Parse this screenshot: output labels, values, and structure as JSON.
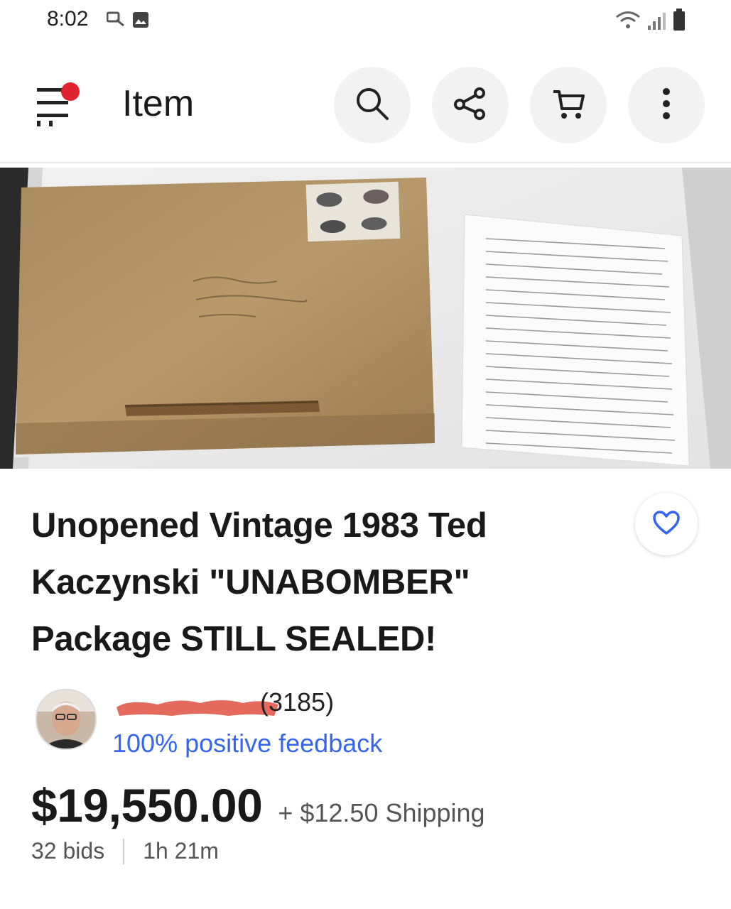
{
  "status_bar": {
    "time": "8:02",
    "icons_left": [
      "notification-icon",
      "image-icon"
    ],
    "icons_right": [
      "wifi-icon",
      "signal-icon",
      "battery-icon"
    ]
  },
  "header": {
    "title": "Item",
    "menu_icon": "menu-icon",
    "actions": [
      "search-icon",
      "share-icon",
      "cart-icon",
      "more-icon"
    ],
    "badge_color": "#e0232e"
  },
  "listing": {
    "title": "Unopened Vintage 1983 Ted Kaczynski \"UNABOMBER\" Package STILL SEALED!",
    "watch_icon": "heart-icon"
  },
  "seller": {
    "feedback_count": "(3185)",
    "feedback_text": "100% positive feedback"
  },
  "pricing": {
    "price": "$19,550.00",
    "shipping": "+ $12.50 Shipping",
    "bids": "32 bids",
    "time_left": "1h 21m"
  },
  "colors": {
    "accent_blue": "#3665f3",
    "redaction": "#e36a5c"
  }
}
